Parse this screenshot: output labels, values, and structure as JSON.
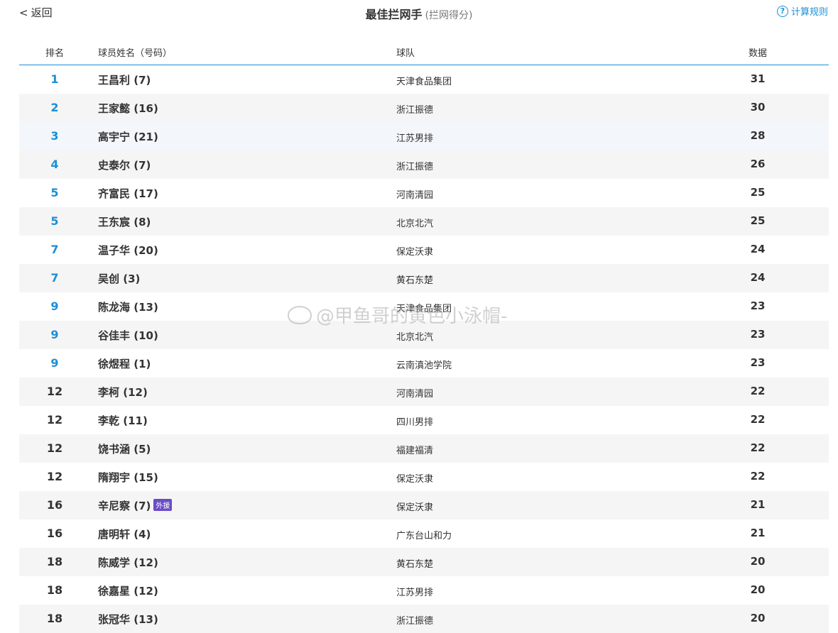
{
  "header": {
    "back_label": "返回",
    "back_chevron": "<",
    "title": "最佳拦网手",
    "subtitle": "(拦网得分)",
    "rules_label": "计算规则",
    "rules_icon": "?"
  },
  "table": {
    "columns": {
      "rank": "排名",
      "name": "球员姓名（号码）",
      "team": "球队",
      "data": "数据"
    },
    "rows": [
      {
        "rank": "1",
        "name": "王昌利 (7)",
        "team": "天津食品集团",
        "value": "31",
        "badge": ""
      },
      {
        "rank": "2",
        "name": "王家懿 (16)",
        "team": "浙江振德",
        "value": "30",
        "badge": ""
      },
      {
        "rank": "3",
        "name": "高宇宁 (21)",
        "team": "江苏男排",
        "value": "28",
        "badge": ""
      },
      {
        "rank": "4",
        "name": "史泰尔 (7)",
        "team": "浙江振德",
        "value": "26",
        "badge": ""
      },
      {
        "rank": "5",
        "name": "齐富民 (17)",
        "team": "河南清园",
        "value": "25",
        "badge": ""
      },
      {
        "rank": "5",
        "name": "王东宸 (8)",
        "team": "北京北汽",
        "value": "25",
        "badge": ""
      },
      {
        "rank": "7",
        "name": "温子华 (20)",
        "team": "保定沃隶",
        "value": "24",
        "badge": ""
      },
      {
        "rank": "7",
        "name": "吴创 (3)",
        "team": "黄石东楚",
        "value": "24",
        "badge": ""
      },
      {
        "rank": "9",
        "name": "陈龙海 (13)",
        "team": "天津食品集团",
        "value": "23",
        "badge": ""
      },
      {
        "rank": "9",
        "name": "谷佳丰 (10)",
        "team": "北京北汽",
        "value": "23",
        "badge": ""
      },
      {
        "rank": "9",
        "name": "徐煜程 (1)",
        "team": "云南滇池学院",
        "value": "23",
        "badge": ""
      },
      {
        "rank": "12",
        "name": "李柯 (12)",
        "team": "河南清园",
        "value": "22",
        "badge": ""
      },
      {
        "rank": "12",
        "name": "李乾 (11)",
        "team": "四川男排",
        "value": "22",
        "badge": ""
      },
      {
        "rank": "12",
        "name": "饶书涵 (5)",
        "team": "福建福清",
        "value": "22",
        "badge": ""
      },
      {
        "rank": "12",
        "name": "隋翔宇 (15)",
        "team": "保定沃隶",
        "value": "22",
        "badge": ""
      },
      {
        "rank": "16",
        "name": "辛尼察 (7)",
        "team": "保定沃隶",
        "value": "21",
        "badge": "外援"
      },
      {
        "rank": "16",
        "name": "唐明轩 (4)",
        "team": "广东台山和力",
        "value": "21",
        "badge": ""
      },
      {
        "rank": "18",
        "name": "陈威学 (12)",
        "team": "黄石东楚",
        "value": "20",
        "badge": ""
      },
      {
        "rank": "18",
        "name": "徐嘉星 (12)",
        "team": "江苏男排",
        "value": "20",
        "badge": ""
      },
      {
        "rank": "18",
        "name": "张冠华 (13)",
        "team": "浙江振德",
        "value": "20",
        "badge": ""
      }
    ]
  },
  "watermark": {
    "text": "@甲鱼哥的黄色小泳帽-"
  },
  "colors": {
    "accent": "#1a8fd6",
    "badge": "#6a4cc7",
    "row_alt": "#f5f5f5"
  }
}
